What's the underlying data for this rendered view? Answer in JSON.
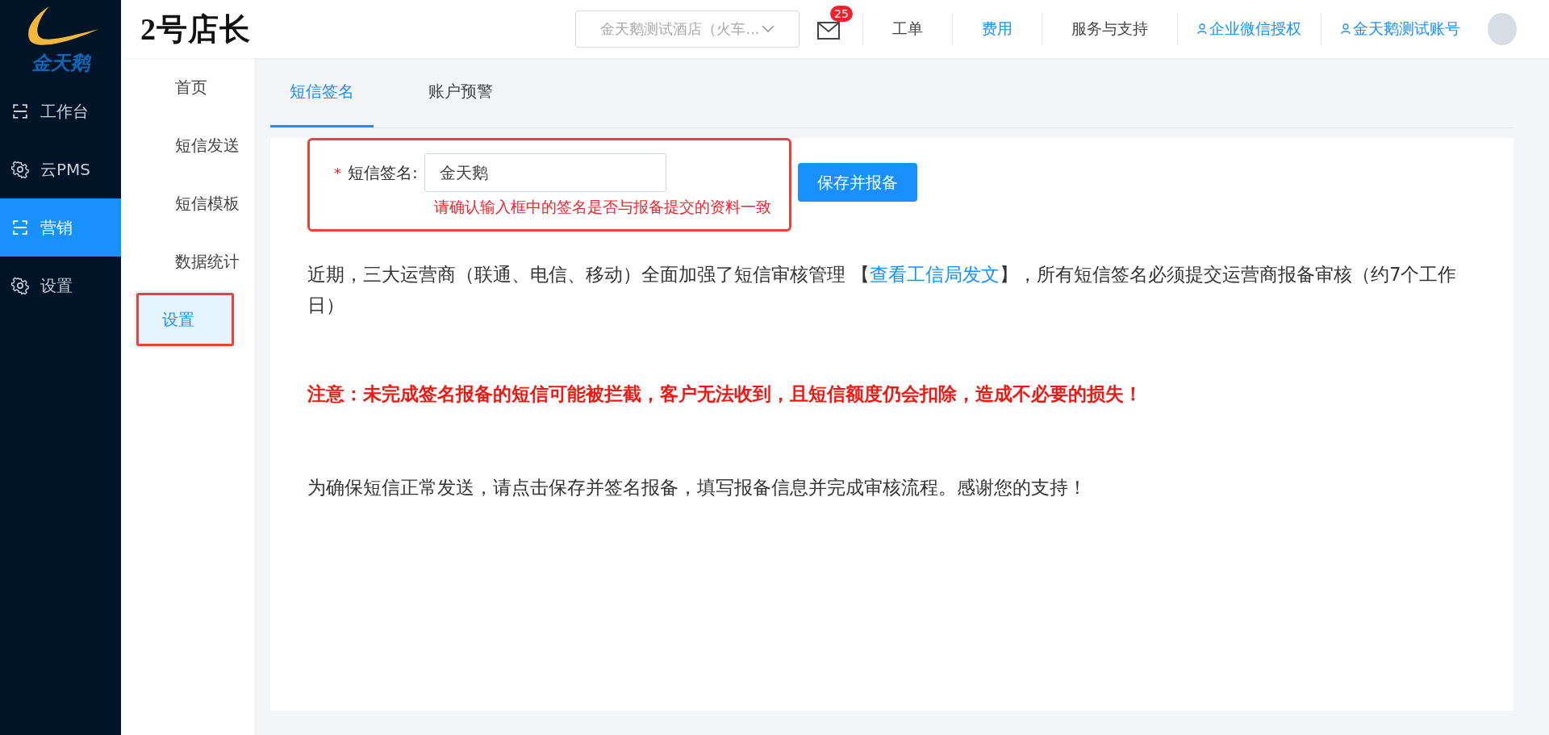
{
  "logo": {
    "text": "金天鹅"
  },
  "brand": {
    "title": "2号店长"
  },
  "main_nav": [
    {
      "label": "工作台",
      "kind": "frame",
      "selected": false
    },
    {
      "label": "云PMS",
      "kind": "gear",
      "selected": false
    },
    {
      "label": "营销",
      "kind": "frame",
      "selected": true
    },
    {
      "label": "设置",
      "kind": "gear",
      "selected": false
    }
  ],
  "top_bar": {
    "hotel_select": {
      "value": "金天鹅测试酒店（火车..."
    },
    "mail_badge": "25",
    "links": [
      {
        "label": "工单",
        "kind": "plain"
      },
      {
        "label": "费用",
        "kind": "accent"
      },
      {
        "label": "服务与支持",
        "kind": "plain"
      },
      {
        "label": "企业微信授权",
        "kind": "user"
      },
      {
        "label": "金天鹅测试账号",
        "kind": "user"
      }
    ]
  },
  "sub_nav": [
    {
      "label": "首页",
      "selected": false,
      "highlighted": false
    },
    {
      "label": "短信发送",
      "selected": false,
      "highlighted": false
    },
    {
      "label": "短信模板",
      "selected": false,
      "highlighted": false
    },
    {
      "label": "数据统计",
      "selected": false,
      "highlighted": false
    },
    {
      "label": "设置",
      "selected": true,
      "highlighted": true
    }
  ],
  "tabs": [
    {
      "label": "短信签名",
      "selected": true
    },
    {
      "label": "账户预警",
      "selected": false
    }
  ],
  "form": {
    "highlighted": true,
    "required": true,
    "required_mark": "*",
    "label": "短信签名:",
    "value": "金天鹅",
    "hint": "请确认输入框中的签名是否与报备提交的资料一致",
    "button": "保存并报备"
  },
  "notice": {
    "before": "近期，三大运营商（联通、电信、移动）全面加强了短信审核管理 【",
    "link": "查看工信局发文",
    "after": "】，所有短信签名必须提交运营商报备审核（约7个工作日）"
  },
  "warning": "注意：未完成签名报备的短信可能被拦截，客户无法收到，且短信额度仍会扣除，造成不必要的损失！",
  "closing": "为确保短信正常发送，请点击保存并签名报备，填写报备信息并完成审核流程。感谢您的支持！"
}
